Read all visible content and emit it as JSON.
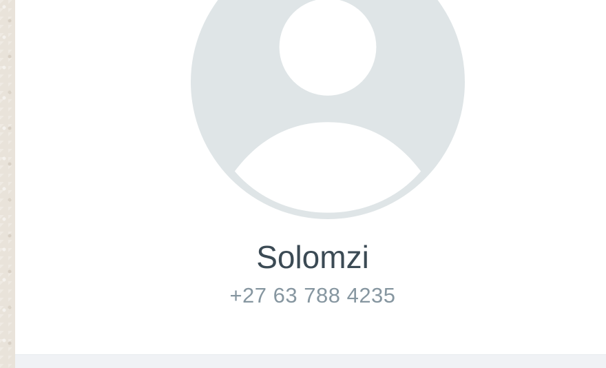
{
  "contact": {
    "name": "Solomzi",
    "phone": "+27 63 788 4235",
    "avatar_icon": "default-person-avatar-icon"
  },
  "colors": {
    "avatar_bg": "#dfe5e7",
    "avatar_fg": "#ffffff",
    "name_text": "#3b4a54",
    "phone_text": "#8696a0",
    "section_bg": "#f0f2f5",
    "chat_wallpaper": "#e9e3da"
  }
}
